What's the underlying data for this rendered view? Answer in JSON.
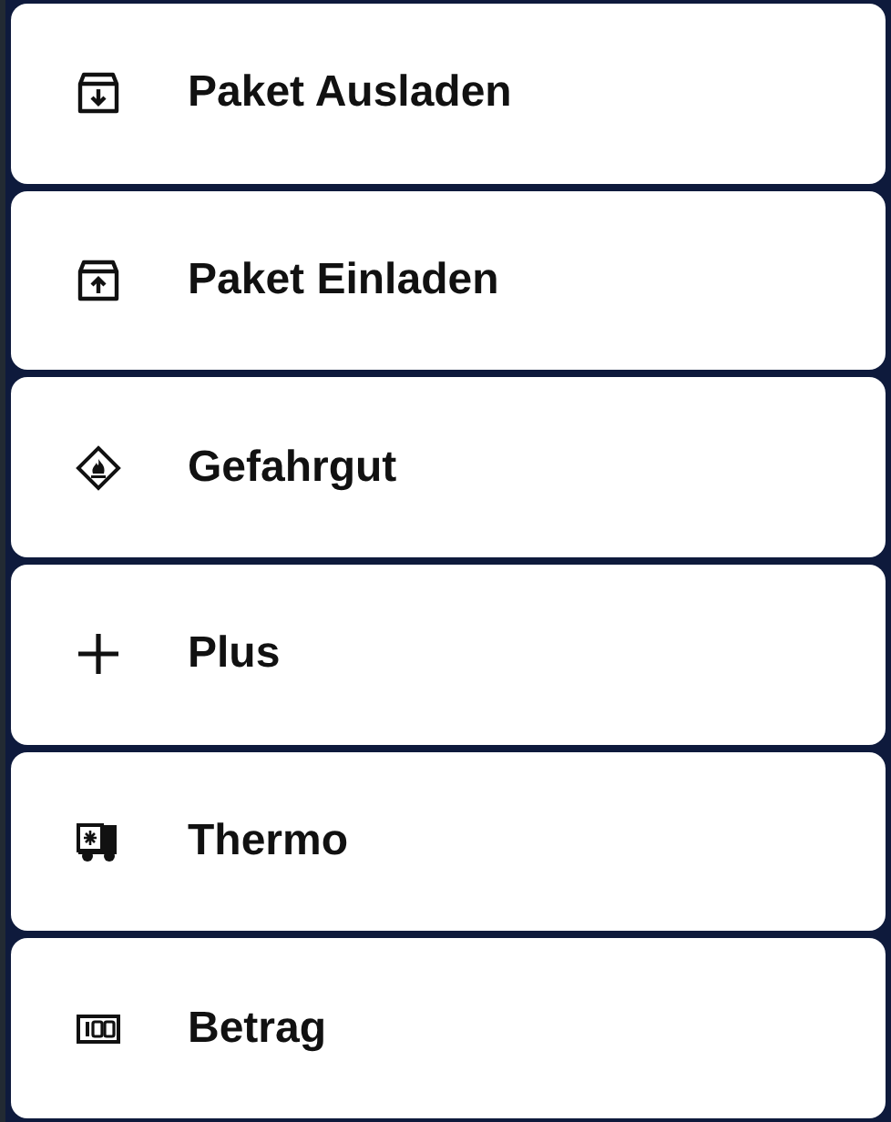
{
  "actions": [
    {
      "label": "Paket Ausladen",
      "kind": "unload"
    },
    {
      "label": "Paket Einladen",
      "kind": "load"
    },
    {
      "label": "Gefahrgut",
      "kind": "hazard"
    },
    {
      "label": "Plus",
      "kind": "plus"
    },
    {
      "label": "Thermo",
      "kind": "thermo"
    },
    {
      "label": "Betrag",
      "kind": "amount"
    }
  ]
}
